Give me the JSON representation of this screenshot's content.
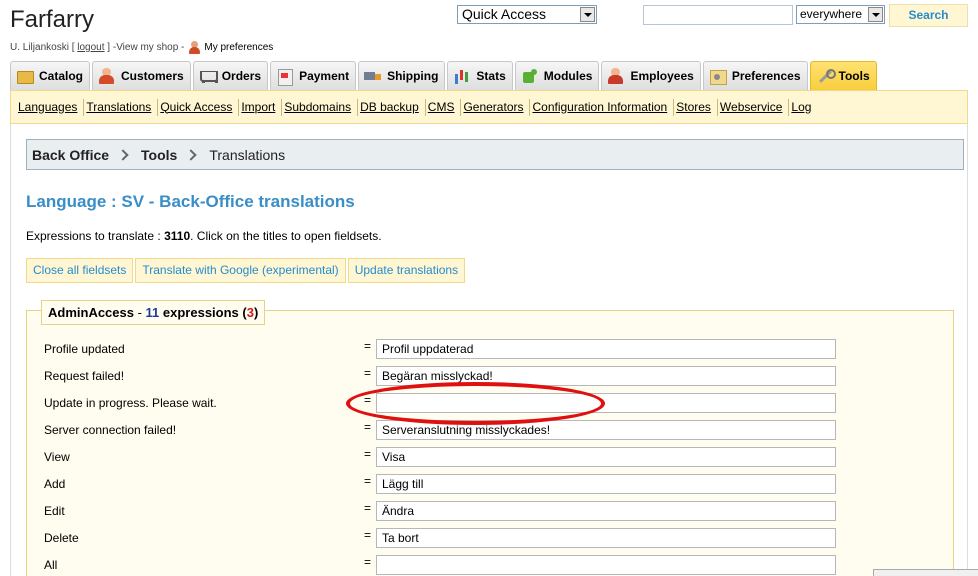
{
  "header": {
    "shop_name": "Farfarry",
    "user_name": "U. Liljankoski",
    "logout_label": "logout",
    "view_shop_label": "View my shop",
    "my_preferences_label": "My preferences",
    "quick_access_label": "Quick Access",
    "search_value": "",
    "search_scope": "everywhere",
    "search_button": "Search"
  },
  "tabs": [
    {
      "label": "Catalog",
      "icon": "catalog-icon"
    },
    {
      "label": "Customers",
      "icon": "customers-icon"
    },
    {
      "label": "Orders",
      "icon": "cart-icon"
    },
    {
      "label": "Payment",
      "icon": "payment-icon"
    },
    {
      "label": "Shipping",
      "icon": "truck-icon"
    },
    {
      "label": "Stats",
      "icon": "chart-icon"
    },
    {
      "label": "Modules",
      "icon": "puzzle-icon"
    },
    {
      "label": "Employees",
      "icon": "employee-icon"
    },
    {
      "label": "Preferences",
      "icon": "preferences-icon"
    },
    {
      "label": "Tools",
      "icon": "tools-icon",
      "active": true
    }
  ],
  "subnav": [
    "Languages",
    "Translations",
    "Quick Access",
    "Import",
    "Subdomains",
    "DB backup",
    "CMS",
    "Generators",
    "Configuration Information",
    "Stores",
    "Webservice",
    "Log"
  ],
  "breadcrumb": [
    "Back Office",
    "Tools",
    "Translations"
  ],
  "page": {
    "title": "Language : SV - Back-Office translations",
    "expr_prefix": "Expressions to translate : ",
    "expr_count": "3110",
    "expr_suffix": ". Click on the titles to open fieldsets."
  },
  "buttons": {
    "close_all": "Close all fieldsets",
    "google": "Translate with Google (experimental)",
    "update": "Update translations"
  },
  "fieldset": {
    "name": "AdminAccess",
    "dash": " - ",
    "count": "11",
    "expressions_word": " expressions (",
    "missing": "3",
    "close_paren": ")",
    "rows": [
      {
        "source": "Profile updated",
        "translation": "Profil uppdaterad"
      },
      {
        "source": "Request failed!",
        "translation": "Begäran misslyckad!"
      },
      {
        "source": "Update in progress. Please wait.",
        "translation": ""
      },
      {
        "source": "Server connection failed!",
        "translation": "Serveranslutning misslyckades!"
      },
      {
        "source": "View",
        "translation": "Visa"
      },
      {
        "source": "Add",
        "translation": "Lägg till"
      },
      {
        "source": "Edit",
        "translation": "Ändra"
      },
      {
        "source": "Delete",
        "translation": "Ta bort"
      },
      {
        "source": "All",
        "translation": ""
      }
    ]
  },
  "colors": {
    "accent_blue": "#3a8ec7",
    "tab_active": "#f7ce3c",
    "highlight_ellipse": "#e01010"
  }
}
